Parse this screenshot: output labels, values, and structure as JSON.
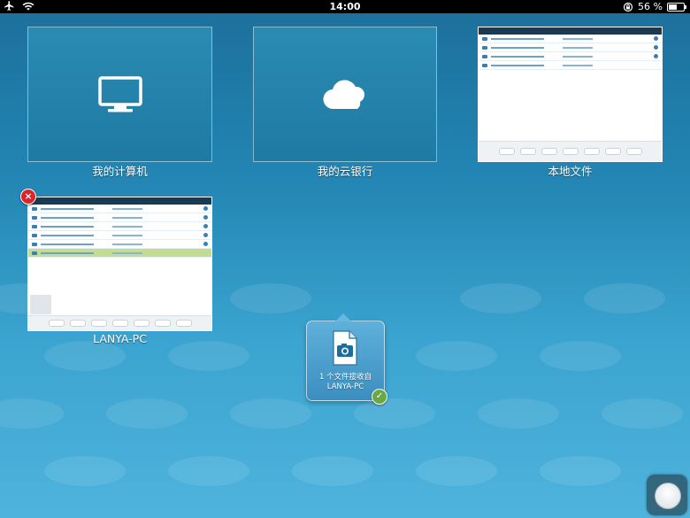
{
  "statusbar": {
    "time": "14:00",
    "battery": "56 %"
  },
  "tiles": [
    {
      "label": "我的计算机"
    },
    {
      "label": "我的云银行"
    },
    {
      "label": "本地文件"
    },
    {
      "label": "LANYA-PC"
    }
  ],
  "popup": {
    "line1": "1 个文件接收自",
    "line2": "LANYA-PC"
  }
}
